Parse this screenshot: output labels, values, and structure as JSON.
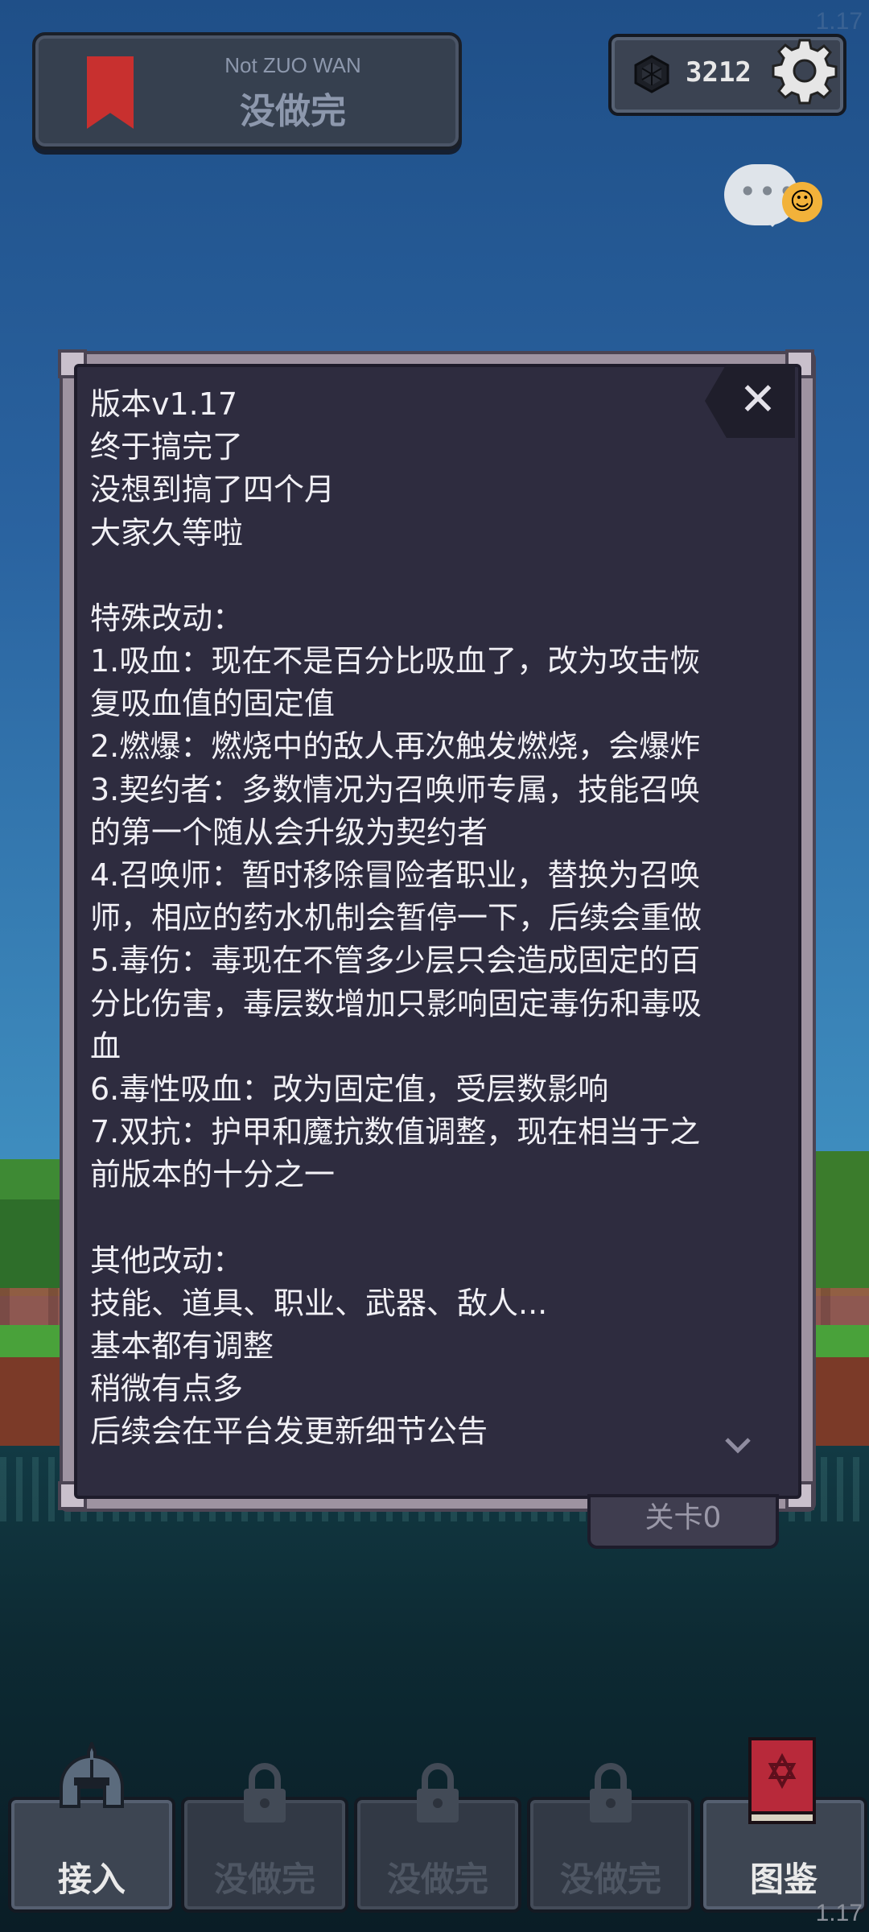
{
  "header": {
    "subtitle": "Not ZUO WAN",
    "title": "没做完"
  },
  "currency": {
    "value": "3212",
    "icon": "gem-icon"
  },
  "notice": {
    "lines": [
      "版本v1.17",
      "终于搞完了",
      "没想到搞了四个月",
      "大家久等啦",
      "",
      "特殊改动：",
      "1.吸血：现在不是百分比吸血了，改为攻击恢",
      "复吸血值的固定值",
      "2.燃爆：燃烧中的敌人再次触发燃烧，会爆炸",
      "3.契约者：多数情况为召唤师专属，技能召唤",
      "的第一个随从会升级为契约者",
      "4.召唤师：暂时移除冒险者职业，替换为召唤",
      "师，相应的药水机制会暂停一下，后续会重做",
      "5.毒伤：毒现在不管多少层只会造成固定的百",
      "分比伤害，毒层数增加只影响固定毒伤和毒吸",
      "血",
      "6.毒性吸血：改为固定值，受层数影响",
      "7.双抗：护甲和魔抗数值调整，现在相当于之",
      "前版本的十分之一",
      "",
      "其他改动：",
      "技能、道具、职业、武器、敌人...",
      "基本都有调整",
      "稍微有点多",
      "后续会在平台发更新细节公告"
    ]
  },
  "behind_button_label": "关卡0",
  "nav": {
    "items": [
      {
        "label": "接入",
        "locked": false,
        "icon": "helmet-icon"
      },
      {
        "label": "没做完",
        "locked": true,
        "icon": "lock-icon"
      },
      {
        "label": "没做完",
        "locked": true,
        "icon": "lock-icon"
      },
      {
        "label": "没做完",
        "locked": true,
        "icon": "lock-icon"
      },
      {
        "label": "图鉴",
        "locked": false,
        "icon": "book-icon"
      }
    ]
  },
  "version": "1.17",
  "colors": {
    "modal_bg": "#2e2c3f",
    "modal_frame": "#9e93a1",
    "text": "#f1f0f5",
    "bookmark": "#c8302f"
  }
}
